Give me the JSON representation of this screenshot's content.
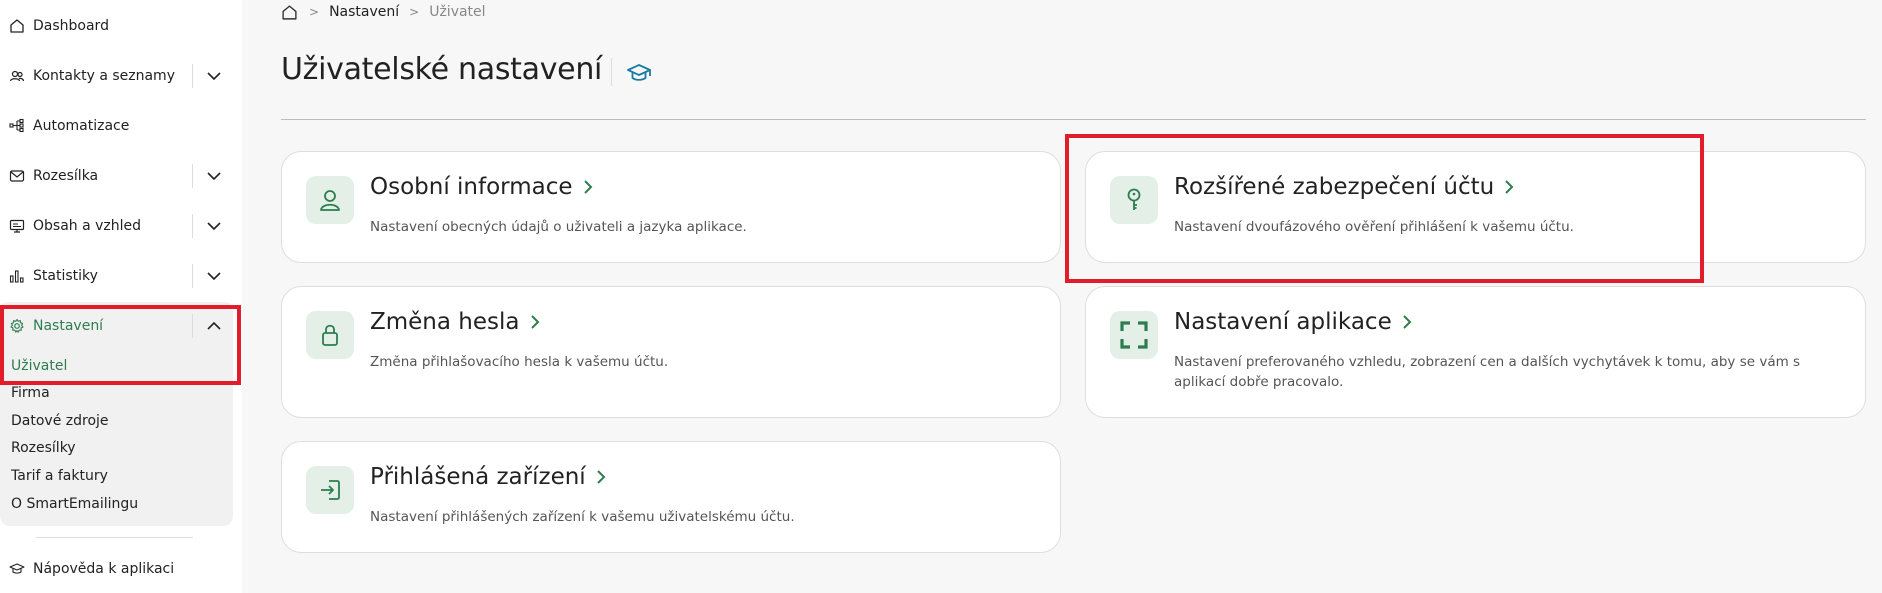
{
  "sidebar": {
    "items": [
      {
        "label": "Dashboard",
        "icon": "home-icon"
      },
      {
        "label": "Kontakty a seznamy",
        "icon": "contacts-icon"
      },
      {
        "label": "Automatizace",
        "icon": "automation-icon"
      },
      {
        "label": "Rozesílka",
        "icon": "mail-icon"
      },
      {
        "label": "Obsah a vzhled",
        "icon": "monitor-icon"
      },
      {
        "label": "Statistiky",
        "icon": "bar-chart-icon"
      },
      {
        "label": "Nastavení",
        "icon": "gear-icon"
      }
    ],
    "submenu": [
      "Uživatel",
      "Firma",
      "Datové zdroje",
      "Rozesílky",
      "Tarif a faktury",
      "O SmartEmailingu"
    ],
    "help": {
      "label": "Nápověda k aplikaci",
      "icon": "graduation-cap-icon"
    }
  },
  "breadcrumb": {
    "items": [
      "Nastavení",
      "Uživatel"
    ]
  },
  "page": {
    "title": "Uživatelské nastavení"
  },
  "cards": [
    {
      "title": "Osobní informace",
      "desc": "Nastavení obecných údajů o uživateli a jazyka aplikace.",
      "icon": "user-icon"
    },
    {
      "title": "Rozšířené zabezpečení účtu",
      "desc": "Nastavení dvoufázového ověření přihlášení k vašemu účtu.",
      "icon": "key-icon"
    },
    {
      "title": "Změna hesla",
      "desc": "Změna přihlašovacího hesla k vašemu účtu.",
      "icon": "lock-icon"
    },
    {
      "title": "Nastavení aplikace",
      "desc": "Nastavení preferovaného vzhledu, zobrazení cen a dalších vychytávek k tomu, aby se vám s aplikací dobře pracovalo.",
      "icon": "expand-icon"
    },
    {
      "title": "Přihlášená zařízení",
      "desc": "Nastavení přihlášených zařízení k vašemu uživatelskému účtu.",
      "icon": "login-icon"
    }
  ],
  "colors": {
    "accent": "#2e7d4f",
    "highlight": "#e11d2b",
    "icon_bg": "#e3efe7"
  }
}
